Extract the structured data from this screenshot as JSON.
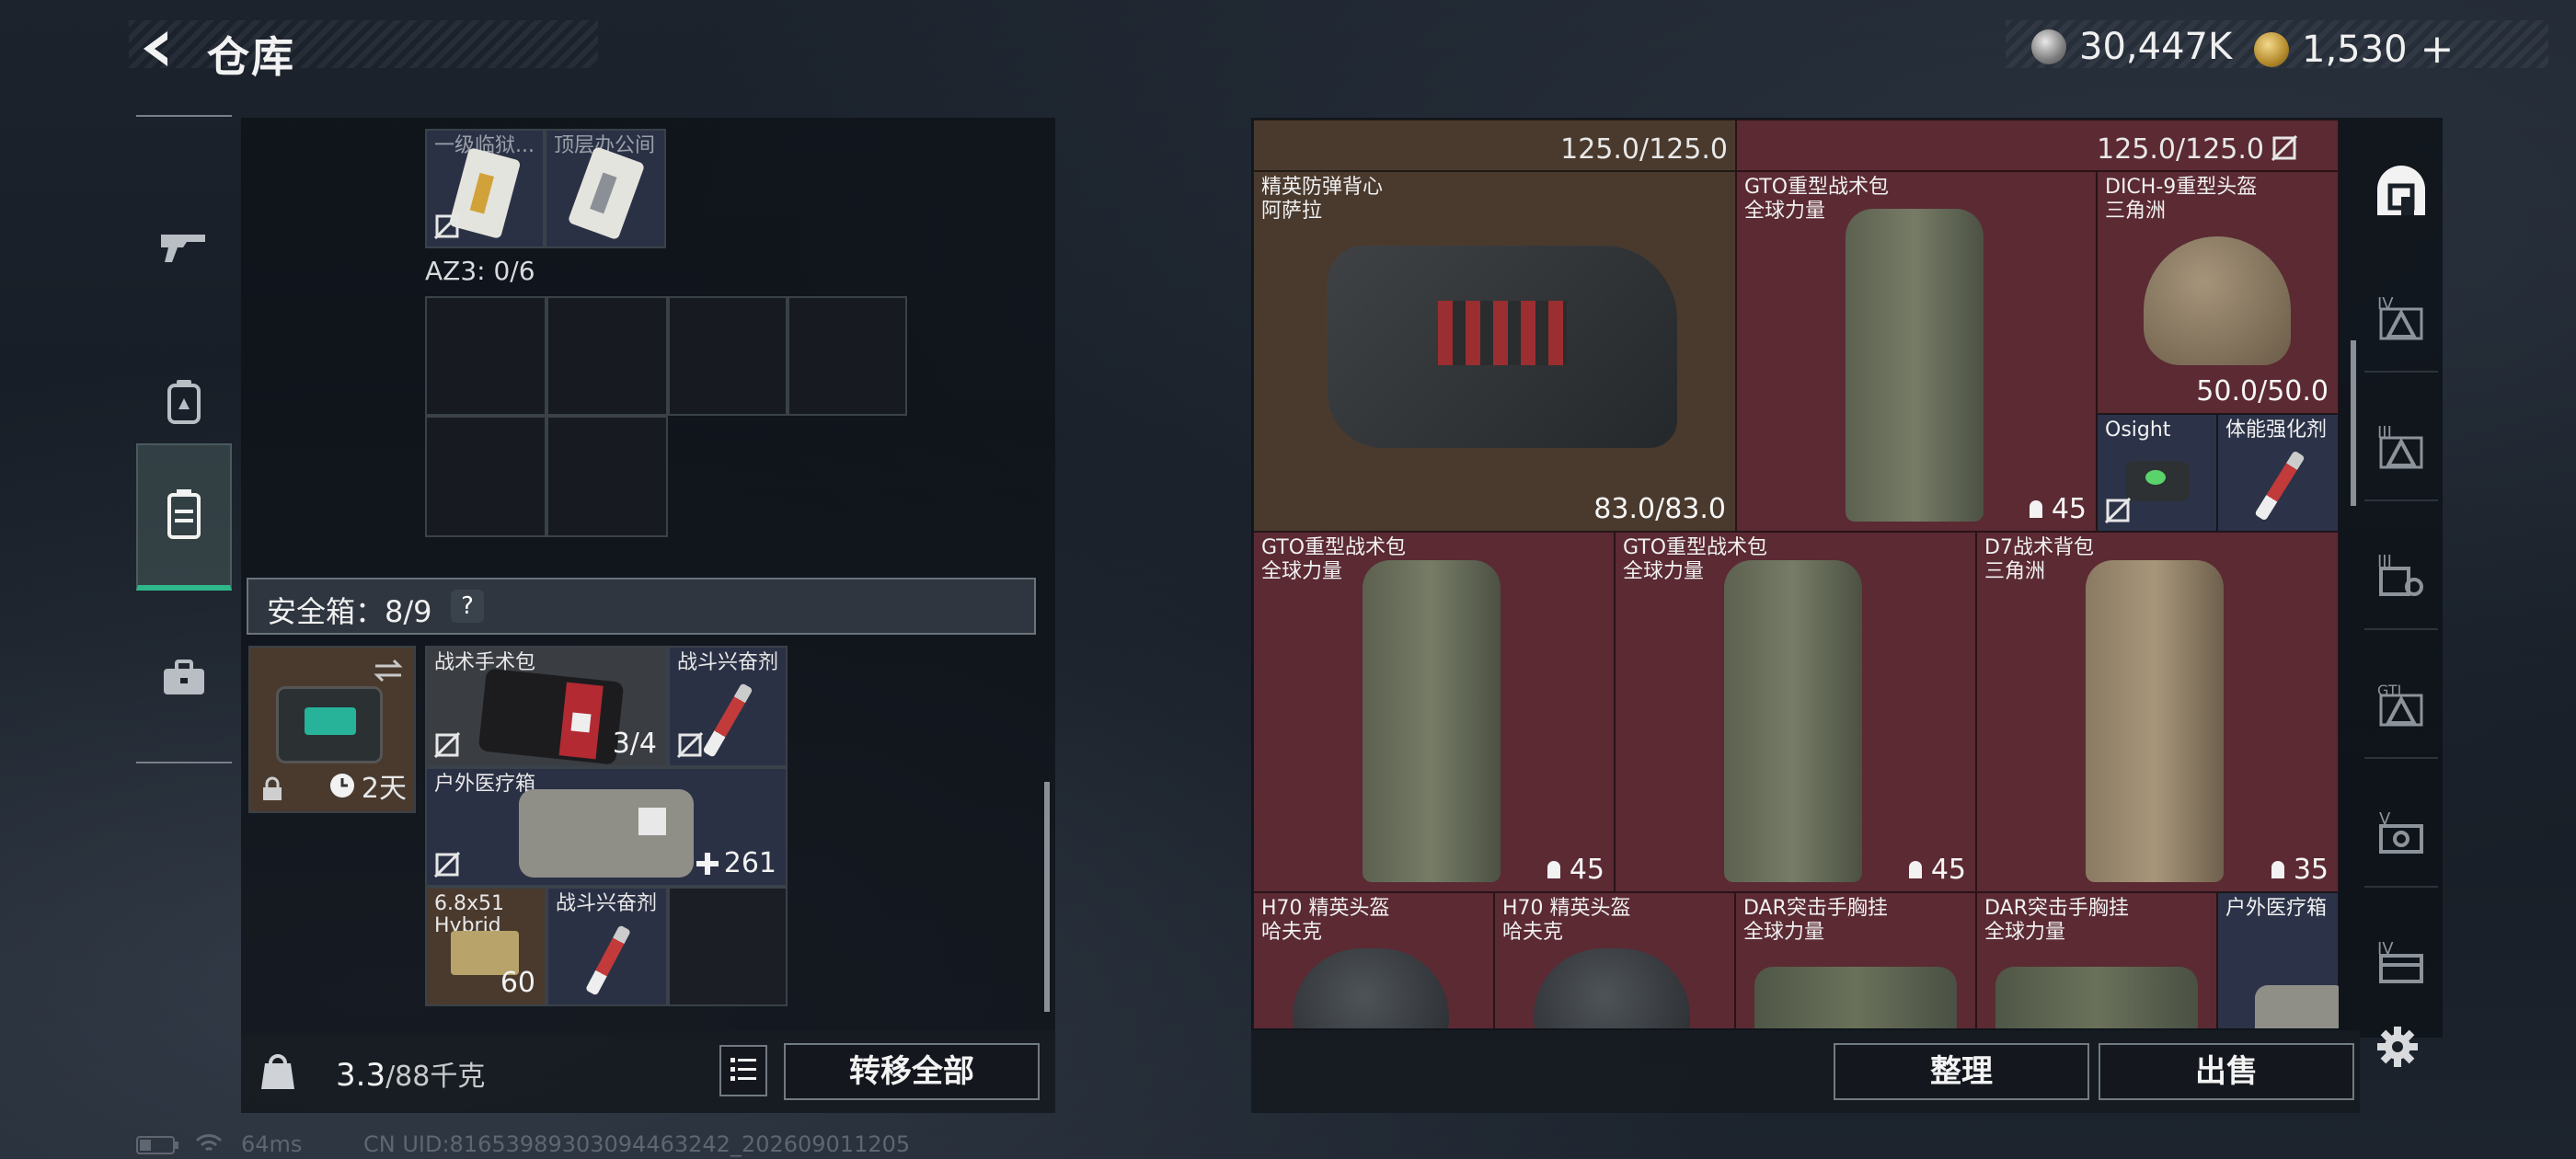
{
  "header": {
    "title": "仓库",
    "currency_silver": "30,447K",
    "currency_gold": "1,530",
    "add_label": "+"
  },
  "sidebar": {
    "items": [
      {
        "name": "weapons",
        "icon": "gun-icon"
      },
      {
        "name": "gear",
        "icon": "backpack-icon"
      },
      {
        "name": "storage",
        "icon": "container-icon",
        "active": true
      },
      {
        "name": "items",
        "icon": "briefcase-icon"
      }
    ]
  },
  "left": {
    "top_items": [
      {
        "label": "一级临狱..."
      },
      {
        "label": "顶层办公间"
      }
    ],
    "az3_label": "AZ3: 0/6",
    "safe_box_label": "安全箱：8/9",
    "help_label": "?",
    "safe_container": {
      "timer": "2天"
    },
    "safe_items": [
      {
        "label": "战术手术包",
        "value": "3/4"
      },
      {
        "label": "战斗兴奋剂",
        "value": ""
      },
      {
        "label": "户外医疗箱",
        "value": "261"
      },
      {
        "label": "6.8x51",
        "label2": "Hybrid",
        "value": "60"
      },
      {
        "label": "战斗兴奋剂",
        "value": ""
      }
    ],
    "weight_value": "3.3",
    "weight_max": "/88千克",
    "transfer_all_label": "转移全部"
  },
  "right": {
    "top_caps": [
      "125.0/125.0",
      "125.0/125.0"
    ],
    "items": [
      {
        "label": "精英防弹背心",
        "label2": "阿萨拉",
        "value": "83.0/83.0"
      },
      {
        "label": "GTO重型战术包",
        "label2": "全球力量",
        "value": "45"
      },
      {
        "label": "DICH-9重型头盔",
        "label2": "三角洲",
        "value": "50.0/50.0"
      },
      {
        "label": "Osight",
        "label2": "",
        "value": ""
      },
      {
        "label": "体能强化剂",
        "label2": "",
        "value": ""
      },
      {
        "label": "GTO重型战术包",
        "label2": "全球力量",
        "value": "45"
      },
      {
        "label": "GTO重型战术包",
        "label2": "全球力量",
        "value": "45"
      },
      {
        "label": "D7战术背包",
        "label2": "三角洲",
        "value": "35"
      },
      {
        "label": "H70 精英头盔",
        "label2": "哈夫克",
        "value": ""
      },
      {
        "label": "H70 精英头盔",
        "label2": "哈夫克",
        "value": ""
      },
      {
        "label": "DAR突击手胸挂",
        "label2": "全球力量",
        "value": ""
      },
      {
        "label": "DAR突击手胸挂",
        "label2": "全球力量",
        "value": ""
      },
      {
        "label": "户外医疗箱",
        "label2": "",
        "value": ""
      }
    ],
    "rail": [
      "home-icon",
      "tier-iv-icon",
      "tier-iii-icon",
      "tier-iii-key-icon",
      "gti-icon",
      "tier-v-icon",
      "tier-iv-case-icon"
    ],
    "sort_label": "整理",
    "sell_label": "出售"
  },
  "footer": {
    "ping": "64ms",
    "uid": "CN UID:8165398930309446​3242_202609011205"
  },
  "colors": {
    "accent_green": "#2fb88a",
    "cell_red": "#5b2a33",
    "cell_blue": "#2c3348"
  }
}
